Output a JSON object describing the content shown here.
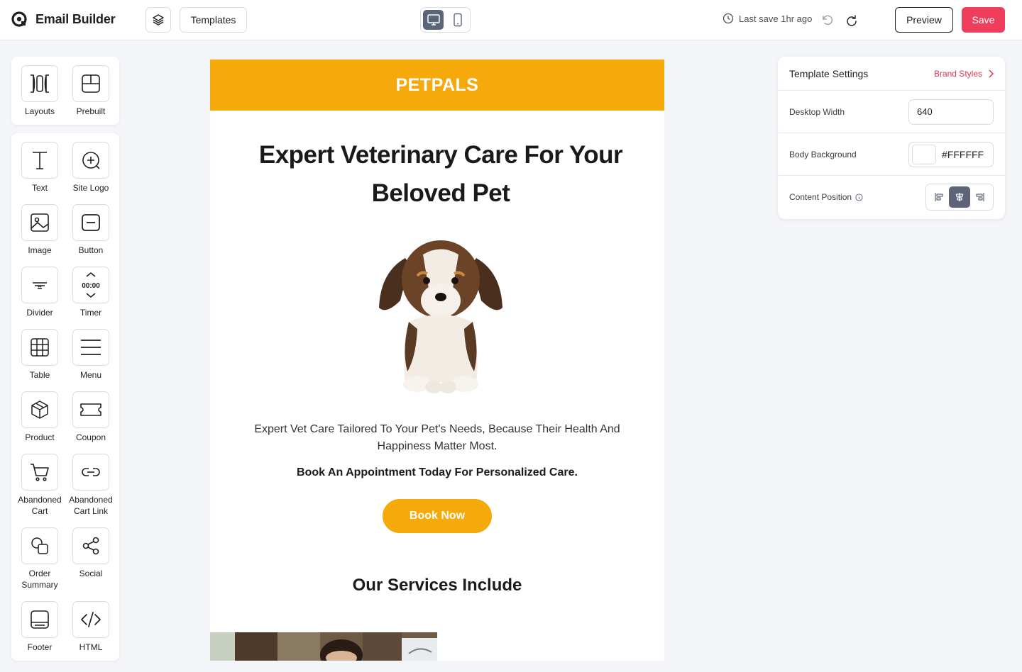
{
  "app": {
    "title": "Email Builder"
  },
  "toolbar": {
    "templates_label": "Templates",
    "last_save": "Last save 1hr ago",
    "preview_label": "Preview",
    "save_label": "Save"
  },
  "top_tools": [
    {
      "label": "Layouts",
      "icon": "layouts-icon"
    },
    {
      "label": "Prebuilt",
      "icon": "prebuilt-icon"
    }
  ],
  "blocks": [
    {
      "label": "Text",
      "icon": "text-icon"
    },
    {
      "label": "Site Logo",
      "icon": "site-logo-icon"
    },
    {
      "label": "Image",
      "icon": "image-icon"
    },
    {
      "label": "Button",
      "icon": "button-icon"
    },
    {
      "label": "Divider",
      "icon": "divider-icon"
    },
    {
      "label": "Timer",
      "icon": "timer-icon"
    },
    {
      "label": "Table",
      "icon": "table-icon"
    },
    {
      "label": "Menu",
      "icon": "menu-icon"
    },
    {
      "label": "Product",
      "icon": "product-icon"
    },
    {
      "label": "Coupon",
      "icon": "coupon-icon"
    },
    {
      "label": "Abandoned Cart",
      "icon": "cart-icon"
    },
    {
      "label": "Abandoned Cart Link",
      "icon": "link-icon"
    },
    {
      "label": "Order Summary",
      "icon": "order-summary-icon"
    },
    {
      "label": "Social",
      "icon": "share-icon"
    },
    {
      "label": "Footer",
      "icon": "footer-icon"
    },
    {
      "label": "HTML",
      "icon": "code-icon"
    }
  ],
  "timer_icon_text": "00:00",
  "email": {
    "brand": "PETPALS",
    "headline": "Expert Veterinary Care For Your Beloved Pet",
    "body": "Expert Vet Care Tailored To Your Pet's Needs, Because Their Health And Happiness Matter Most.",
    "cta_text": "Book An Appointment Today For Personalized Care.",
    "button_label": "Book Now",
    "services_title": "Our Services Include",
    "accent_color": "#f5a90a"
  },
  "settings": {
    "title": "Template Settings",
    "brand_styles_label": "Brand Styles",
    "desktop_width_label": "Desktop Width",
    "desktop_width_value": "640",
    "body_background_label": "Body Background",
    "body_background_value": "#FFFFFF",
    "content_position_label": "Content Position",
    "content_position_selected": "center"
  },
  "colors": {
    "save": "#ef3e5c",
    "active_toggle": "#5b6577"
  }
}
